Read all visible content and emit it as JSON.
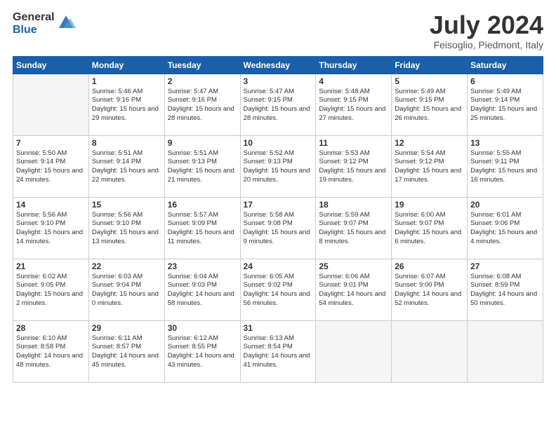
{
  "header": {
    "logo_general": "General",
    "logo_blue": "Blue",
    "title": "July 2024",
    "location": "Feisoglio, Piedmont, Italy"
  },
  "days_of_week": [
    "Sunday",
    "Monday",
    "Tuesday",
    "Wednesday",
    "Thursday",
    "Friday",
    "Saturday"
  ],
  "weeks": [
    [
      {
        "day": "",
        "empty": true
      },
      {
        "day": "1",
        "sunrise": "5:46 AM",
        "sunset": "9:16 PM",
        "daylight": "15 hours and 29 minutes."
      },
      {
        "day": "2",
        "sunrise": "5:47 AM",
        "sunset": "9:16 PM",
        "daylight": "15 hours and 28 minutes."
      },
      {
        "day": "3",
        "sunrise": "5:47 AM",
        "sunset": "9:15 PM",
        "daylight": "15 hours and 28 minutes."
      },
      {
        "day": "4",
        "sunrise": "5:48 AM",
        "sunset": "9:15 PM",
        "daylight": "15 hours and 27 minutes."
      },
      {
        "day": "5",
        "sunrise": "5:49 AM",
        "sunset": "9:15 PM",
        "daylight": "15 hours and 26 minutes."
      },
      {
        "day": "6",
        "sunrise": "5:49 AM",
        "sunset": "9:14 PM",
        "daylight": "15 hours and 25 minutes."
      }
    ],
    [
      {
        "day": "7",
        "sunrise": "5:50 AM",
        "sunset": "9:14 PM",
        "daylight": "15 hours and 24 minutes."
      },
      {
        "day": "8",
        "sunrise": "5:51 AM",
        "sunset": "9:14 PM",
        "daylight": "15 hours and 22 minutes."
      },
      {
        "day": "9",
        "sunrise": "5:51 AM",
        "sunset": "9:13 PM",
        "daylight": "15 hours and 21 minutes."
      },
      {
        "day": "10",
        "sunrise": "5:52 AM",
        "sunset": "9:13 PM",
        "daylight": "15 hours and 20 minutes."
      },
      {
        "day": "11",
        "sunrise": "5:53 AM",
        "sunset": "9:12 PM",
        "daylight": "15 hours and 19 minutes."
      },
      {
        "day": "12",
        "sunrise": "5:54 AM",
        "sunset": "9:12 PM",
        "daylight": "15 hours and 17 minutes."
      },
      {
        "day": "13",
        "sunrise": "5:55 AM",
        "sunset": "9:11 PM",
        "daylight": "15 hours and 16 minutes."
      }
    ],
    [
      {
        "day": "14",
        "sunrise": "5:56 AM",
        "sunset": "9:10 PM",
        "daylight": "15 hours and 14 minutes."
      },
      {
        "day": "15",
        "sunrise": "5:56 AM",
        "sunset": "9:10 PM",
        "daylight": "15 hours and 13 minutes."
      },
      {
        "day": "16",
        "sunrise": "5:57 AM",
        "sunset": "9:09 PM",
        "daylight": "15 hours and 11 minutes."
      },
      {
        "day": "17",
        "sunrise": "5:58 AM",
        "sunset": "9:08 PM",
        "daylight": "15 hours and 9 minutes."
      },
      {
        "day": "18",
        "sunrise": "5:59 AM",
        "sunset": "9:07 PM",
        "daylight": "15 hours and 8 minutes."
      },
      {
        "day": "19",
        "sunrise": "6:00 AM",
        "sunset": "9:07 PM",
        "daylight": "15 hours and 6 minutes."
      },
      {
        "day": "20",
        "sunrise": "6:01 AM",
        "sunset": "9:06 PM",
        "daylight": "15 hours and 4 minutes."
      }
    ],
    [
      {
        "day": "21",
        "sunrise": "6:02 AM",
        "sunset": "9:05 PM",
        "daylight": "15 hours and 2 minutes."
      },
      {
        "day": "22",
        "sunrise": "6:03 AM",
        "sunset": "9:04 PM",
        "daylight": "15 hours and 0 minutes."
      },
      {
        "day": "23",
        "sunrise": "6:04 AM",
        "sunset": "9:03 PM",
        "daylight": "14 hours and 58 minutes."
      },
      {
        "day": "24",
        "sunrise": "6:05 AM",
        "sunset": "9:02 PM",
        "daylight": "14 hours and 56 minutes."
      },
      {
        "day": "25",
        "sunrise": "6:06 AM",
        "sunset": "9:01 PM",
        "daylight": "14 hours and 54 minutes."
      },
      {
        "day": "26",
        "sunrise": "6:07 AM",
        "sunset": "9:00 PM",
        "daylight": "14 hours and 52 minutes."
      },
      {
        "day": "27",
        "sunrise": "6:08 AM",
        "sunset": "8:59 PM",
        "daylight": "14 hours and 50 minutes."
      }
    ],
    [
      {
        "day": "28",
        "sunrise": "6:10 AM",
        "sunset": "8:58 PM",
        "daylight": "14 hours and 48 minutes."
      },
      {
        "day": "29",
        "sunrise": "6:11 AM",
        "sunset": "8:57 PM",
        "daylight": "14 hours and 45 minutes."
      },
      {
        "day": "30",
        "sunrise": "6:12 AM",
        "sunset": "8:55 PM",
        "daylight": "14 hours and 43 minutes."
      },
      {
        "day": "31",
        "sunrise": "6:13 AM",
        "sunset": "8:54 PM",
        "daylight": "14 hours and 41 minutes."
      },
      {
        "day": "",
        "empty": true
      },
      {
        "day": "",
        "empty": true
      },
      {
        "day": "",
        "empty": true
      }
    ]
  ]
}
